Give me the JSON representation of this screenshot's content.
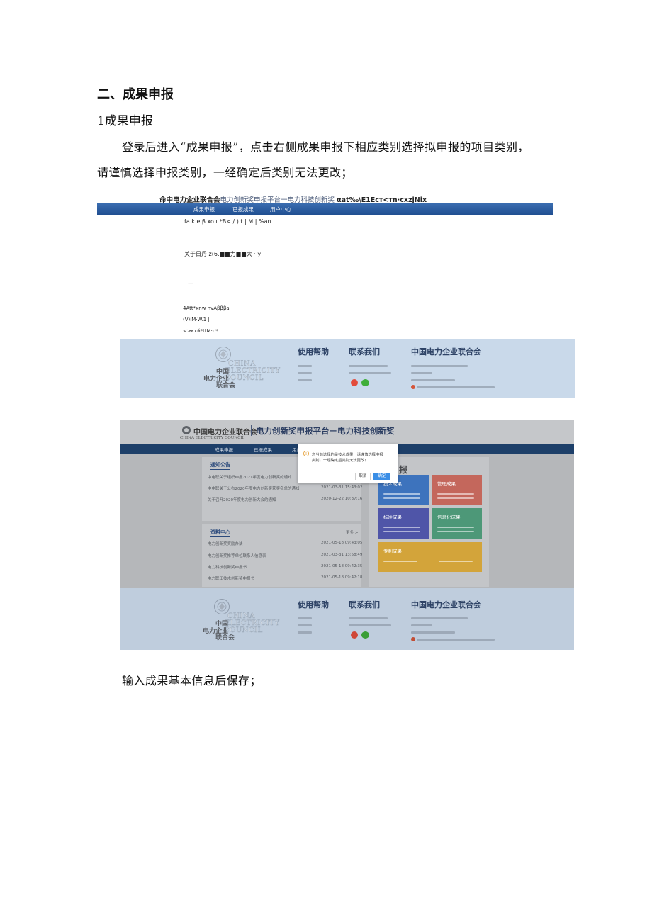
{
  "heading": "二、成果申报",
  "subheading": "1成果申报",
  "intro": {
    "line1": "登录后进入“成果申报”，点击右侧成果申报下相应类别选择拟申报的项目类别，",
    "line2": "请谨慎选择申报类别，一经确定后类别无法更改；"
  },
  "shot1": {
    "title_org": "命中电力企业联合会",
    "title_platform": "电力创新奖申报平台一电力科技创新奖",
    "title_garbled": "αat‰\\E1Eст<тn·cxzjNix",
    "nav": [
      "成果申报",
      "已报成果",
      "用户中心"
    ],
    "lines": [
      "fa k e β xo ι *B< / ) t | M | %an",
      "关于日丹 z(6.■■力■■大 · y",
      "—",
      "4Att*xnw·nvAβββa",
      "(V)iM·W.1 |",
      "<>кхй*ttM·n*"
    ]
  },
  "footer": {
    "logo_en": [
      "CHINA",
      "ELECTRICITY",
      "COUNCIL"
    ],
    "logo_cn": [
      "中国",
      "电力企业",
      "联合会"
    ],
    "help_title": "使用帮助",
    "contact_title": "联系我们",
    "org_title": "中国电力企业联合会",
    "icons": [
      "weibo-icon",
      "wechat-icon"
    ]
  },
  "shot2": {
    "site_name": "中国电力企业联合会",
    "site_name_en": "CHINA ELECTRICITY COUNCIL",
    "platform": "电力创新奖申报平台－电力科技创新奖",
    "nav": [
      "成果申报",
      "已报成果",
      "用户中心"
    ],
    "notices": {
      "title": "通知公告",
      "items": [
        {
          "text": "中电联关于组织申报2021年度电力创新奖的通知",
          "date": ""
        },
        {
          "text": "中电联关于公布2020年度电力创新奖获奖名单的通知",
          "date": "2021-03-31 15:43:02"
        },
        {
          "text": "关于召开2020年度电力创新大会的通知",
          "date": "2020-12-22 10:37:16"
        }
      ]
    },
    "resources": {
      "title": "资料中心",
      "more": "更多 >",
      "items": [
        {
          "text": "电力创新奖奖励办法",
          "date": "2021-05-18 09:43:05"
        },
        {
          "text": "电力创新奖推荐单位联系人信息表",
          "date": "2021-03-31 13:58:49"
        },
        {
          "text": "电力科技创新奖申报书",
          "date": "2021-05-18 09:42:35"
        },
        {
          "text": "电力职工技术创新奖申报书",
          "date": "2021-05-18 09:42:18"
        }
      ]
    },
    "apply": {
      "title": "成果申报",
      "tiles": [
        {
          "label": "技术成果",
          "color": "#3d73bd"
        },
        {
          "label": "管理成果",
          "color": "#c4675c"
        },
        {
          "label": "标准成果",
          "color": "#4f55a8"
        },
        {
          "label": "信息化成果",
          "color": "#4d9878"
        },
        {
          "label": "专利成果",
          "color": "#d3a43a"
        }
      ]
    },
    "dialog": {
      "message_line1": "您当前选择的是技术成果，请谨慎选择申报",
      "message_line2": "类别，一经确定后类别无法更改！",
      "cancel": "取消",
      "confirm": "确定",
      "icon": "info-icon"
    }
  },
  "closing": "输入成果基本信息后保存；",
  "colors": {
    "nav_blue": "#1f4d8f",
    "footer_bg": "#c9d9ea",
    "confirm_blue": "#3a8ee6"
  }
}
